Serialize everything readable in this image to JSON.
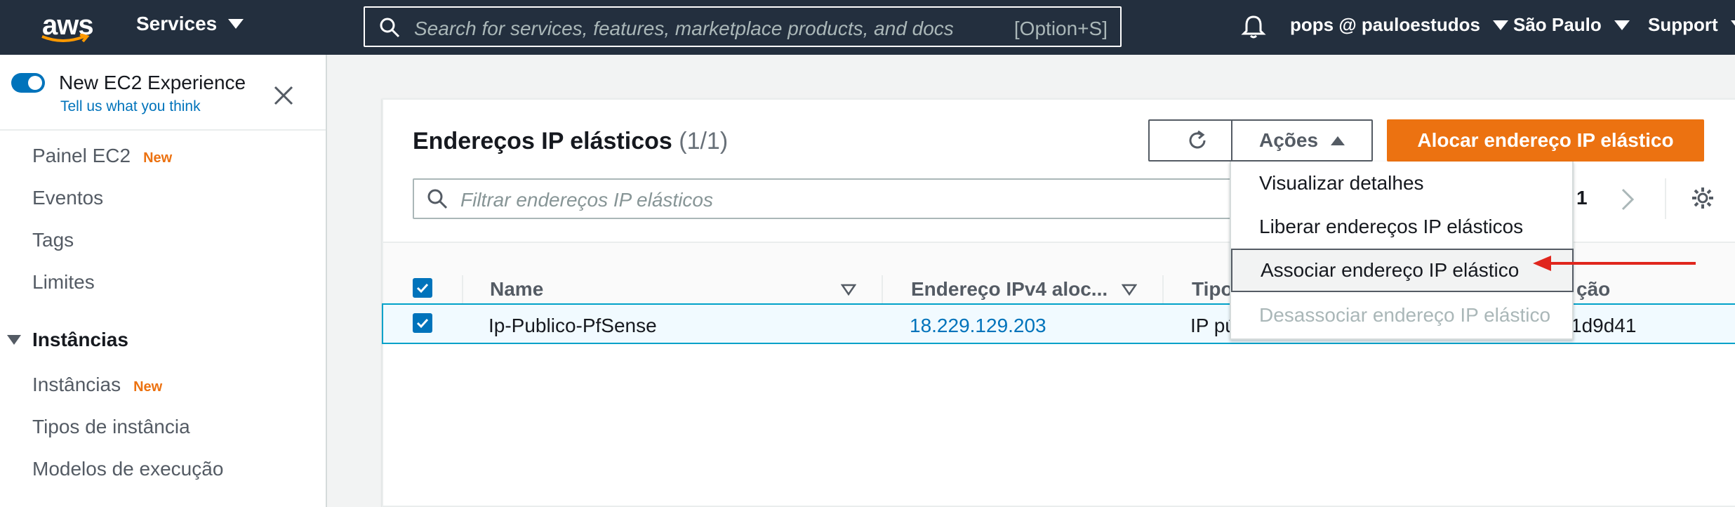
{
  "topnav": {
    "logo": "aws",
    "services": "Services",
    "search_placeholder": "Search for services, features, marketplace products, and docs",
    "search_shortcut": "[Option+S]",
    "user": "pops @ pauloestudos",
    "region": "São Paulo",
    "support": "Support"
  },
  "sidebar": {
    "experience_title": "New EC2 Experience",
    "experience_link": "Tell us what you think",
    "items": [
      {
        "label": "Painel EC2",
        "badge": "New"
      },
      {
        "label": "Eventos",
        "badge": ""
      },
      {
        "label": "Tags",
        "badge": ""
      },
      {
        "label": "Limites",
        "badge": ""
      }
    ],
    "section": "Instâncias",
    "section_items": [
      {
        "label": "Instâncias",
        "badge": "New"
      },
      {
        "label": "Tipos de instância",
        "badge": ""
      },
      {
        "label": "Modelos de execução",
        "badge": ""
      }
    ]
  },
  "panel": {
    "title": "Endereços IP elásticos",
    "count": "(1/1)",
    "actions_label": "Ações",
    "allocate_label": "Alocar endereço IP elástico",
    "filter_placeholder": "Filtrar endereços IP elásticos",
    "page_number": "1"
  },
  "table": {
    "columns": [
      "Name",
      "Endereço IPv4 aloc...",
      "Tipo",
      "ção"
    ],
    "row": {
      "name": "Ip-Publico-PfSense",
      "ip": "18.229.129.203",
      "type": "IP pú",
      "last": "1d9d41"
    }
  },
  "dropdown": {
    "items": [
      {
        "label": "Visualizar detalhes",
        "state": "normal"
      },
      {
        "label": "Liberar endereços IP elásticos",
        "state": "normal"
      },
      {
        "label": "Associar endereço IP elástico",
        "state": "highlighted"
      },
      {
        "label": "Desassociar endereço IP elástico",
        "state": "disabled"
      }
    ]
  },
  "colors": {
    "nav_bg": "#232f3e",
    "accent_orange": "#ec7211",
    "link_blue": "#0073bb",
    "annotation_arrow": "#e0261d"
  }
}
